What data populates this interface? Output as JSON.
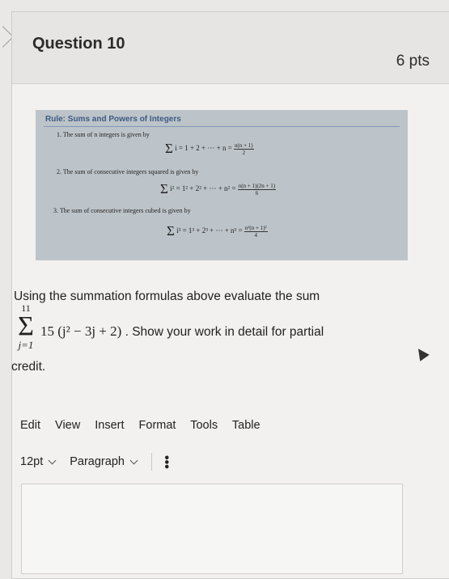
{
  "question": {
    "title": "Question 10",
    "points": "6 pts"
  },
  "rule": {
    "title": "Rule: Sums and Powers of Integers",
    "item1": "1.  The sum of n integers is given by",
    "formula1": {
      "lhs": "i = 1 + 2 + ··· + n =",
      "num": "n(n + 1)",
      "den": "2",
      "lim_top": "n",
      "lim_bot": "i=1"
    },
    "item2": "2.  The sum of consecutive integers squared is given by",
    "formula2": {
      "lhs": "i² = 1² + 2² + ··· + n² =",
      "num": "n(n + 1)(2n + 1)",
      "den": "6",
      "lim_top": "n",
      "lim_bot": "i=1"
    },
    "item3": "3.  The sum of consecutive integers cubed is given by",
    "formula3": {
      "lhs": "i³ = 1³ + 2³ + ··· + n³ =",
      "num": "n²(n + 1)²",
      "den": "4",
      "lim_top": "n",
      "lim_bot": "i=1"
    }
  },
  "prompt": {
    "line1": "Using the summation formulas above evaluate the sum",
    "sum_upper": "11",
    "sum_lower": "j=1",
    "expression": "15 (j² − 3j + 2)",
    "line2_tail": ". Show your work in detail for partial",
    "line3": "credit."
  },
  "editor": {
    "menu": [
      "Edit",
      "View",
      "Insert",
      "Format",
      "Tools",
      "Table"
    ],
    "font_size": "12pt",
    "block_format": "Paragraph",
    "more_icon": "more-vertical-icon"
  }
}
